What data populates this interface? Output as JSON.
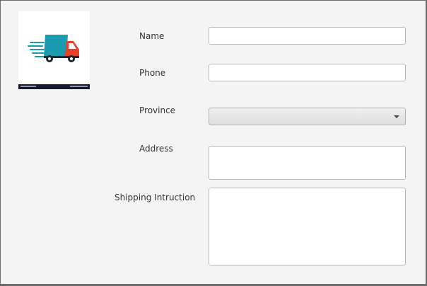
{
  "logo": {
    "icon": "delivery-truck-icon",
    "colors": {
      "cargo": "#1a9bb0",
      "cab": "#e8412b",
      "wheel": "#1e2430",
      "footer": "#141a2b"
    }
  },
  "form": {
    "name_label": "Name",
    "name_value": "",
    "phone_label": "Phone",
    "phone_value": "",
    "province_label": "Province",
    "province_value": "",
    "address_label": "Address",
    "address_value": "",
    "shipping_label": "Shipping Intruction",
    "shipping_value": ""
  }
}
